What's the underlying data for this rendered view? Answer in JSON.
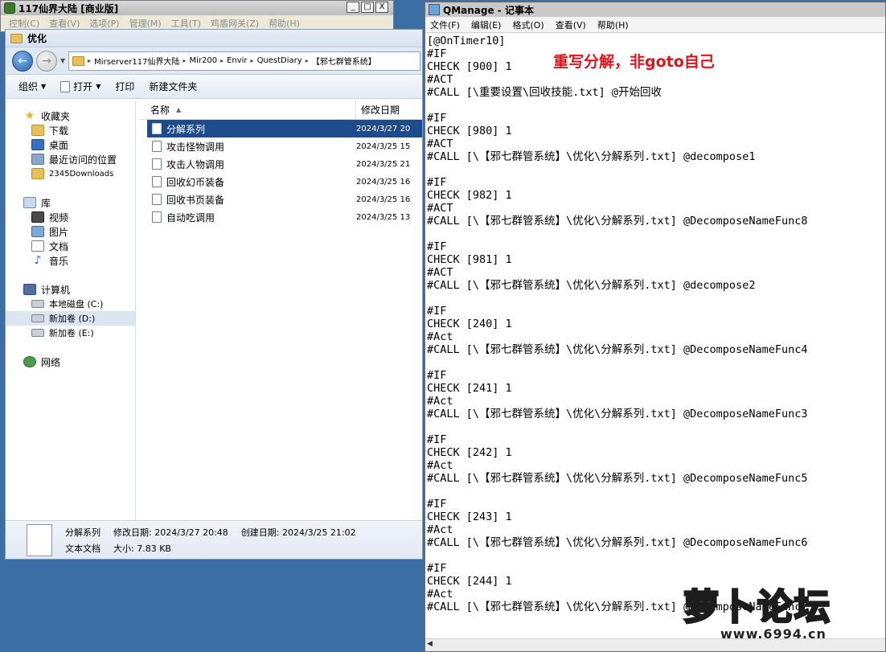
{
  "game_window": {
    "title": "117仙界大陆 [商业版]",
    "menu": [
      "控制(C)",
      "查看(V)",
      "选项(P)",
      "管理(M)",
      "工具(T)",
      "鸡盾网关(Z)",
      "帮助(H)"
    ],
    "buttons": {
      "minimize": "_",
      "maximize": "□",
      "close": "X"
    }
  },
  "explorer": {
    "title": "优化",
    "address_crumbs": [
      "Mirserver117仙界大陆",
      "Mir200",
      "Envir",
      "QuestDiary",
      "【邪七群管系统】"
    ],
    "toolbar": {
      "organize": "组织",
      "open": "打开",
      "print": "打印",
      "new_folder": "新建文件夹"
    },
    "nav": {
      "favorites": "收藏夹",
      "fav_items": [
        "下载",
        "桌面",
        "最近访问的位置",
        "2345Downloads"
      ],
      "library": "库",
      "lib_items": [
        "视频",
        "图片",
        "文档",
        "音乐"
      ],
      "computer": "计算机",
      "computer_items": [
        "本地磁盘 (C:)",
        "新加卷 (D:)",
        "新加卷 (E:)"
      ],
      "network": "网络"
    },
    "columns": {
      "name": "名称",
      "date": "修改日期"
    },
    "files": [
      {
        "name": "分解系列",
        "date": "2024/3/27 20"
      },
      {
        "name": "攻击怪物调用",
        "date": "2024/3/25 15"
      },
      {
        "name": "攻击人物调用",
        "date": "2024/3/25 21"
      },
      {
        "name": "回收幻币装备",
        "date": "2024/3/25 16"
      },
      {
        "name": "回收书页装备",
        "date": "2024/3/25 16"
      },
      {
        "name": "自动吃调用",
        "date": "2024/3/25 13"
      }
    ],
    "details": {
      "name": "分解系列",
      "modified": "修改日期: 2024/3/27 20:48",
      "created": "创建日期: 2024/3/25 21:02",
      "type": "文本文档",
      "size": "大小: 7.83 KB"
    }
  },
  "notepad": {
    "title": "QManage - 记事本",
    "menu": [
      "文件(F)",
      "编辑(E)",
      "格式(O)",
      "查看(V)",
      "帮助(H)"
    ],
    "lines": [
      "[@OnTimer10]",
      "#IF",
      "CHECK [900] 1",
      "#ACT",
      "#CALL [\\重要设置\\回收技能.txt] @开始回收",
      "",
      "#IF",
      "CHECK [980] 1",
      "#ACT",
      "#CALL [\\【邪七群管系统】\\优化\\分解系列.txt] @decompose1",
      "",
      "#IF",
      "CHECK [982] 1",
      "#ACT",
      "#CALL [\\【邪七群管系统】\\优化\\分解系列.txt] @DecomposeNameFunc8",
      "",
      "#IF",
      "CHECK [981] 1",
      "#ACT",
      "#CALL [\\【邪七群管系统】\\优化\\分解系列.txt] @decompose2",
      "",
      "#IF",
      "CHECK [240] 1",
      "#Act",
      "#CALL [\\【邪七群管系统】\\优化\\分解系列.txt] @DecomposeNameFunc4",
      "",
      "#IF",
      "CHECK [241] 1",
      "#Act",
      "#CALL [\\【邪七群管系统】\\优化\\分解系列.txt] @DecomposeNameFunc3",
      "",
      "#IF",
      "CHECK [242] 1",
      "#Act",
      "#CALL [\\【邪七群管系统】\\优化\\分解系列.txt] @DecomposeNameFunc5",
      "",
      "#IF",
      "CHECK [243] 1",
      "#Act",
      "#CALL [\\【邪七群管系统】\\优化\\分解系列.txt] @DecomposeNameFunc6",
      "",
      "#IF",
      "CHECK [244] 1",
      "#Act",
      "#CALL [\\【邪七群管系统】\\优化\\分解系列.txt] @DecomposeNameFunc7"
    ],
    "annotation": "重写分解，非goto自己"
  },
  "watermark": {
    "title": "萝卜论坛",
    "url": "www.6994.cn"
  }
}
